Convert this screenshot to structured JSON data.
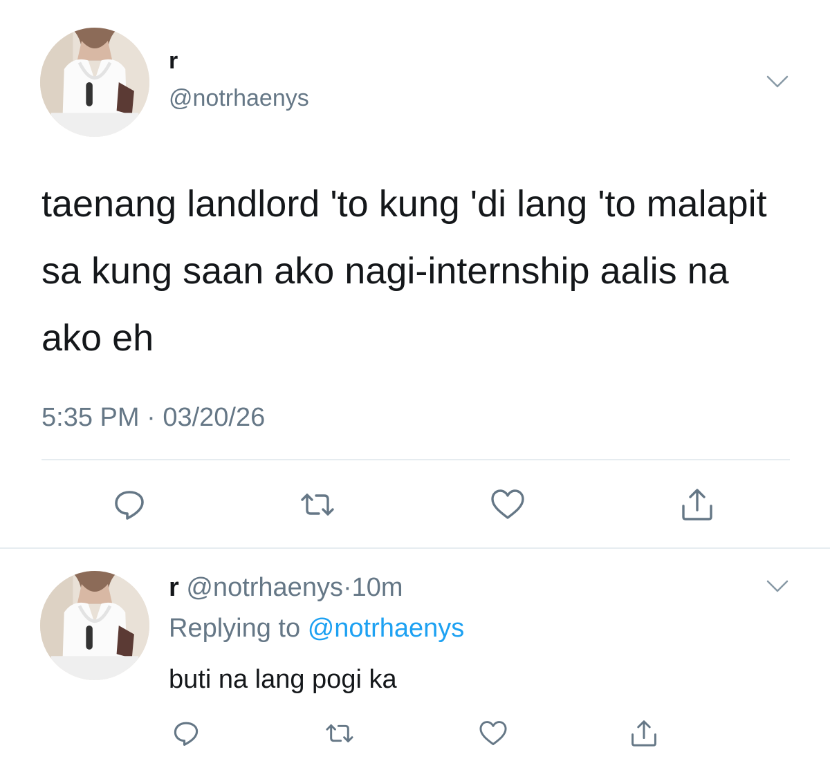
{
  "main_tweet": {
    "avatar_icon": "profile-photo",
    "name": "r",
    "handle": "@notrhaenys",
    "text": "taenang landlord 'to kung 'di lang 'to malapit sa kung saan ako nagi-internship aalis na ako eh",
    "time": "5:35 PM",
    "separator": "·",
    "date": "03/20/26",
    "actions": [
      "reply-icon",
      "retweet-icon",
      "like-icon",
      "share-icon"
    ]
  },
  "reply_tweet": {
    "avatar_icon": "profile-photo",
    "name": "r",
    "handle": "@notrhaenys",
    "separator": "·",
    "time_ago": "10m",
    "replying_label": "Replying to",
    "replying_mention": "@notrhaenys",
    "text": "buti na lang pogi ka",
    "actions": [
      "reply-icon",
      "retweet-icon",
      "like-icon",
      "share-icon"
    ]
  },
  "colors": {
    "text": "#14171a",
    "secondary": "#657786",
    "link": "#1da1f2",
    "divider": "#e6ecf0"
  }
}
